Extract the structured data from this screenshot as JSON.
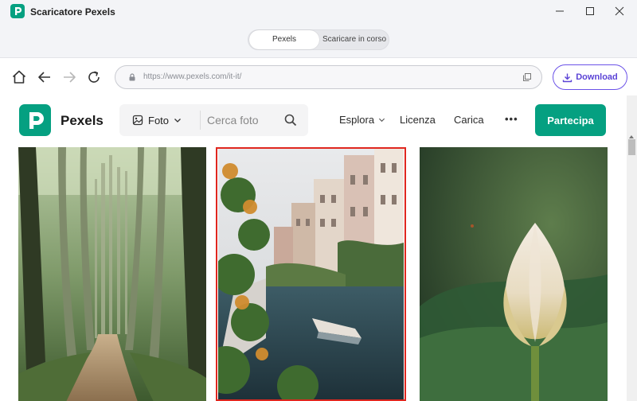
{
  "app": {
    "title": "Scaricatore Pexels"
  },
  "tabs": [
    {
      "label": "Pexels",
      "active": true
    },
    {
      "label": "Scaricare in corso",
      "active": false
    }
  ],
  "browser": {
    "url": "https://www.pexels.com/it-it/",
    "download_label": "Download",
    "accent_color": "#6b52e8"
  },
  "site": {
    "brand": "Pexels",
    "brand_color": "#05a081",
    "search": {
      "type_label": "Foto",
      "placeholder": "Cerca foto"
    },
    "menu": [
      {
        "label": "Esplora",
        "has_dropdown": true
      },
      {
        "label": "Licenza"
      },
      {
        "label": "Carica"
      }
    ],
    "more_label": "•••",
    "join_label": "Partecipa"
  },
  "photos": [
    {
      "subject": "forest-path",
      "selected": false
    },
    {
      "subject": "canal-houses-boat",
      "selected": true
    },
    {
      "subject": "lotus-bud",
      "selected": false
    }
  ],
  "selection_color": "#e0271f"
}
